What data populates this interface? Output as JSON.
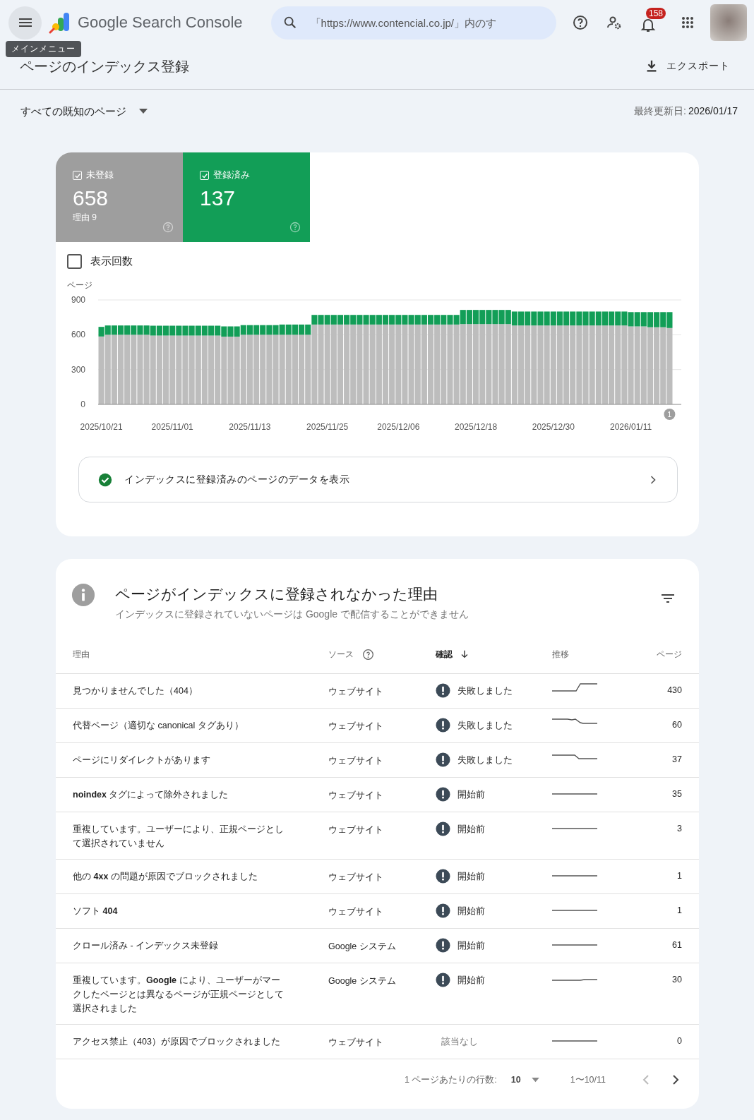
{
  "header": {
    "menu_tooltip": "メインメニュー",
    "product": "Google Search Console",
    "search": {
      "placeholder": "「https://www.contencial.co.jp/」内のす"
    },
    "notifications_badge": "158"
  },
  "page": {
    "title": "ページのインデックス登録",
    "export": "エクスポート",
    "filter": "すべての既知のページ",
    "updated_label": "最終更新日:",
    "updated_date": "2026/01/17"
  },
  "stat_cards": [
    {
      "label": "未登録",
      "value": "658",
      "sub": "理由 9",
      "selected": true,
      "color": "#9e9e9e"
    },
    {
      "label": "登録済み",
      "value": "137",
      "selected": true,
      "color": "#129e57"
    }
  ],
  "impressions": {
    "label": "表示回数",
    "checked": false
  },
  "chart_marker": "1",
  "chart_data": {
    "type": "bar",
    "stacked": true,
    "ylabel": "ページ",
    "ylim": [
      0,
      900
    ],
    "yticks": [
      0,
      300,
      600,
      900
    ],
    "categories": [
      "2025/10/21",
      null,
      null,
      null,
      null,
      null,
      null,
      null,
      null,
      null,
      null,
      "2025/11/01",
      null,
      null,
      null,
      null,
      null,
      null,
      null,
      null,
      null,
      null,
      null,
      "2025/11/13",
      null,
      null,
      null,
      null,
      null,
      null,
      null,
      null,
      null,
      null,
      null,
      "2025/11/25",
      null,
      null,
      null,
      null,
      null,
      null,
      null,
      null,
      null,
      null,
      "2025/12/06",
      null,
      null,
      null,
      null,
      null,
      null,
      null,
      null,
      null,
      null,
      null,
      "2025/12/18",
      null,
      null,
      null,
      null,
      null,
      null,
      null,
      null,
      null,
      null,
      null,
      "2025/12/30",
      null,
      null,
      null,
      null,
      null,
      null,
      null,
      null,
      null,
      null,
      null,
      "2026/01/11",
      null,
      null,
      null,
      null,
      null,
      null
    ],
    "series": [
      {
        "color": "#bdbdbd",
        "values": [
          585,
          600,
          600,
          600,
          600,
          600,
          600,
          600,
          593,
          593,
          593,
          593,
          593,
          593,
          593,
          593,
          593,
          593,
          593,
          584,
          584,
          584,
          600,
          600,
          600,
          600,
          600,
          600,
          600,
          600,
          600,
          600,
          600,
          688,
          688,
          688,
          688,
          688,
          688,
          688,
          688,
          688,
          688,
          688,
          688,
          688,
          688,
          688,
          688,
          688,
          688,
          688,
          688,
          688,
          688,
          688,
          692,
          692,
          692,
          692,
          692,
          692,
          692,
          692,
          680,
          680,
          680,
          680,
          680,
          680,
          680,
          680,
          680,
          680,
          680,
          680,
          680,
          680,
          680,
          680,
          680,
          680,
          672,
          672,
          672,
          665,
          665,
          665,
          658
        ]
      },
      {
        "color": "#129e57",
        "values": [
          83,
          80,
          80,
          80,
          80,
          80,
          80,
          80,
          85,
          85,
          85,
          85,
          85,
          85,
          85,
          85,
          85,
          85,
          85,
          88,
          88,
          88,
          83,
          83,
          83,
          83,
          83,
          83,
          88,
          88,
          88,
          88,
          88,
          83,
          83,
          83,
          83,
          83,
          83,
          83,
          83,
          83,
          83,
          83,
          83,
          83,
          83,
          83,
          83,
          83,
          83,
          83,
          83,
          83,
          83,
          83,
          122,
          122,
          122,
          122,
          122,
          122,
          122,
          122,
          120,
          120,
          120,
          120,
          120,
          120,
          120,
          120,
          120,
          120,
          120,
          120,
          120,
          120,
          120,
          120,
          120,
          120,
          123,
          123,
          123,
          130,
          130,
          130,
          137
        ]
      }
    ]
  },
  "indexed_link": "インデックスに登録済みのページのデータを表示",
  "reasons": {
    "title": "ページがインデックスに登録されなかった理由",
    "subtitle": "インデックスに登録されていないページは Google で配信することができません",
    "columns": [
      {
        "label": "理由",
        "sorted": false
      },
      {
        "label": "ソース",
        "sorted": false
      },
      {
        "label": "確認",
        "sorted": true
      },
      {
        "label": "推移",
        "sorted": false
      },
      {
        "label": "ページ",
        "sorted": false
      }
    ],
    "rows": [
      {
        "reason": "見つかりませんでした（404）",
        "source": "ウェブサイト",
        "status": {
          "kind": "failed",
          "text": "失敗しました"
        },
        "trend": {
          "kind": "step_up"
        },
        "pages": "430"
      },
      {
        "reason": "代替ページ（適切な canonical タグあり）",
        "source": "ウェブサイト",
        "status": {
          "kind": "failed",
          "text": "失敗しました"
        },
        "trend": {
          "kind": "step_down"
        },
        "pages": "60"
      },
      {
        "reason": "ページにリダイレクトがあります",
        "source": "ウェブサイト",
        "status": {
          "kind": "failed",
          "text": "失敗しました"
        },
        "trend": {
          "kind": "drop"
        },
        "pages": "37"
      },
      {
        "reason": "**noindex** タグによって除外されました",
        "source": "ウェブサイト",
        "status": {
          "kind": "pending",
          "text": "開始前"
        },
        "trend": {
          "kind": "flat"
        },
        "pages": "35"
      },
      {
        "reason": "重複しています。ユーザーにより、正規ページとして選択されていません",
        "source": "ウェブサイト",
        "status": {
          "kind": "pending",
          "text": "開始前"
        },
        "trend": {
          "kind": "flat"
        },
        "pages": "3"
      },
      {
        "reason": "他の **4xx** の問題が原因でブロックされました",
        "source": "ウェブサイト",
        "status": {
          "kind": "pending",
          "text": "開始前"
        },
        "trend": {
          "kind": "flat"
        },
        "pages": "1"
      },
      {
        "reason": "ソフト **404**",
        "source": "ウェブサイト",
        "status": {
          "kind": "pending",
          "text": "開始前"
        },
        "trend": {
          "kind": "flat"
        },
        "pages": "1"
      },
      {
        "reason": "クロール済み - インデックス未登録",
        "source": "Google システム",
        "status": {
          "kind": "pending",
          "text": "開始前"
        },
        "trend": {
          "kind": "flat"
        },
        "pages": "61"
      },
      {
        "reason": "重複しています。**Google** により、ユーザーがマークしたページとは異なるページが正規ページとして選択されました",
        "source": "Google システム",
        "status": {
          "kind": "pending",
          "text": "開始前"
        },
        "trend": {
          "kind": "slight_up"
        },
        "pages": "30"
      },
      {
        "reason": "アクセス禁止（403）が原因でブロックされました",
        "source": "ウェブサイト",
        "status": {
          "kind": "na",
          "text": "該当なし"
        },
        "trend": {
          "kind": "flat"
        },
        "pages": "0"
      }
    ]
  },
  "pagination": {
    "rows_label": "1 ページあたりの行数:",
    "rows_value": "10",
    "range": "1〜10/11",
    "prev_disabled": true,
    "next_disabled": false
  }
}
